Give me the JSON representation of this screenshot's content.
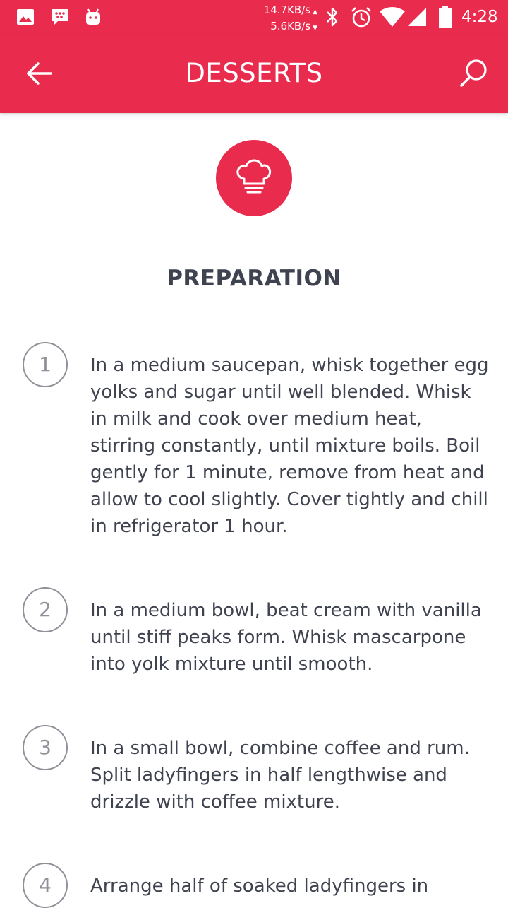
{
  "status_bar": {
    "speed_up": "14.7KB/s",
    "speed_down": "5.6KB/s",
    "time": "4:28",
    "icons": [
      "image-icon",
      "blackberry-messenger-icon",
      "android-icon",
      "bluetooth-icon",
      "alarm-icon",
      "wifi-icon",
      "signal-icon",
      "battery-icon"
    ]
  },
  "app_bar": {
    "title": "DESSERTS",
    "back_icon": "arrow-left-icon",
    "search_icon": "search-icon"
  },
  "header_icon": "chef-hat-icon",
  "section_title": "PREPARATION",
  "steps": [
    {
      "number": "1",
      "text": "In a medium saucepan, whisk together egg yolks and sugar until well blended. Whisk in milk and cook over medium heat, stirring constantly, until mixture boils. Boil gently for 1 minute, remove from heat and allow to cool slightly. Cover tightly and chill in refrigerator 1 hour."
    },
    {
      "number": "2",
      "text": "In a medium bowl, beat cream with vanilla until stiff peaks form. Whisk mascarpone into yolk mixture until smooth."
    },
    {
      "number": "3",
      "text": "In a small bowl, combine coffee and rum. Split ladyfingers in half lengthwise and drizzle with coffee mixture."
    },
    {
      "number": "4",
      "text": "Arrange half of soaked ladyfingers in"
    }
  ],
  "colors": {
    "primary": "#e92c4d",
    "text": "#3f4350",
    "step_circle": "#8f9199"
  }
}
